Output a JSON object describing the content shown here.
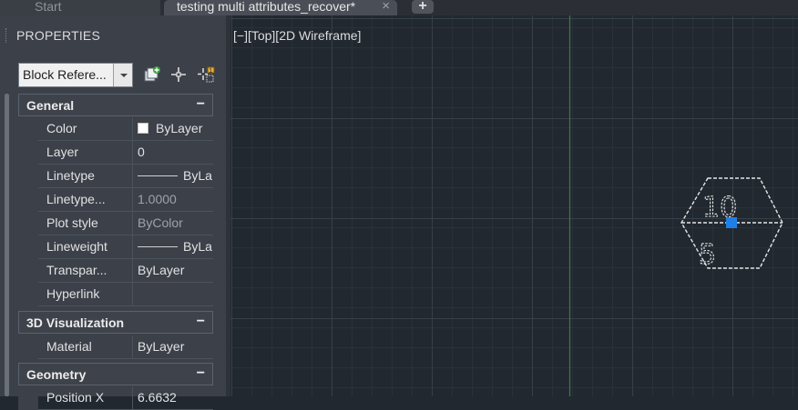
{
  "tabs": {
    "start_label": "Start",
    "active_label": "testing multi attributes_recover*",
    "close_symbol": "×",
    "add_symbol": "+"
  },
  "palette": {
    "title": "PROPERTIES",
    "selector_value": "Block Refere...",
    "tools": [
      "quick-select-icon",
      "select-objects-icon",
      "toggle-pickadd-icon"
    ],
    "sections": {
      "general": {
        "label": "General",
        "collapse": "−",
        "rows": [
          {
            "name": "Color",
            "value": "ByLayer"
          },
          {
            "name": "Layer",
            "value": "0"
          },
          {
            "name": "Linetype",
            "value": "ByLa..."
          },
          {
            "name": "Linetype...",
            "value": "1.0000"
          },
          {
            "name": "Plot style",
            "value": "ByColor"
          },
          {
            "name": "Lineweight",
            "value": "ByLa..."
          },
          {
            "name": "Transpar...",
            "value": "ByLayer"
          },
          {
            "name": "Hyperlink",
            "value": ""
          }
        ]
      },
      "visualization": {
        "label": "3D Visualization",
        "collapse": "−",
        "rows": [
          {
            "name": "Material",
            "value": "ByLayer"
          }
        ]
      },
      "geometry": {
        "label": "Geometry",
        "collapse": "−",
        "rows": [
          {
            "name": "Position X",
            "value": "6.6632"
          }
        ]
      }
    }
  },
  "viewport": {
    "label": "[−][Top][2D Wireframe]",
    "block": {
      "top_value": "10",
      "bottom_value": "5"
    }
  },
  "colors": {
    "canvas_bg": "#212830",
    "grid_minor": "#2a313a",
    "grid_major": "#364049",
    "y_axis": "#3f7a3f",
    "grip": "#1e7fe8",
    "palette_bg": "#3b4049"
  }
}
